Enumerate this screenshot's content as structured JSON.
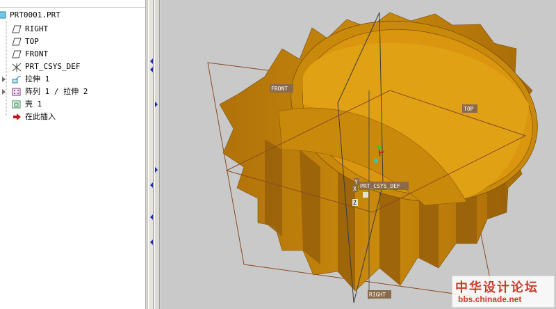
{
  "tree": {
    "root": "PRT0001.PRT",
    "items": [
      {
        "label": "RIGHT",
        "icon": "datum-plane-icon",
        "expandable": false
      },
      {
        "label": "TOP",
        "icon": "datum-plane-icon",
        "expandable": false
      },
      {
        "label": "FRONT",
        "icon": "datum-plane-icon",
        "expandable": false
      },
      {
        "label": "PRT_CSYS_DEF",
        "icon": "coordinate-system-icon",
        "expandable": false
      },
      {
        "label": "拉伸 1",
        "icon": "extrude-icon",
        "expandable": true
      },
      {
        "label": "阵列 1 / 拉伸 2",
        "icon": "pattern-icon",
        "expandable": true
      },
      {
        "label": "壳 1",
        "icon": "shell-icon",
        "expandable": false
      },
      {
        "label": "在此插入",
        "icon": "insert-here-arrow-icon",
        "expandable": false
      }
    ]
  },
  "viewport": {
    "datum_labels": {
      "front": "FRONT",
      "top": "TOP",
      "right": "RIGHT",
      "csys": "PRT_CSYS_DEF",
      "axis_x": "X",
      "axis_y": "Y",
      "axis_z": "Z"
    },
    "colors": {
      "background": "#c9c9c9",
      "model": "#c98a0c",
      "model_dark": "#8a5a08",
      "datum_plane": "#8a4a20"
    }
  },
  "watermark": {
    "site_name": "中华设计论坛",
    "url": "bbs.chinade.net"
  }
}
